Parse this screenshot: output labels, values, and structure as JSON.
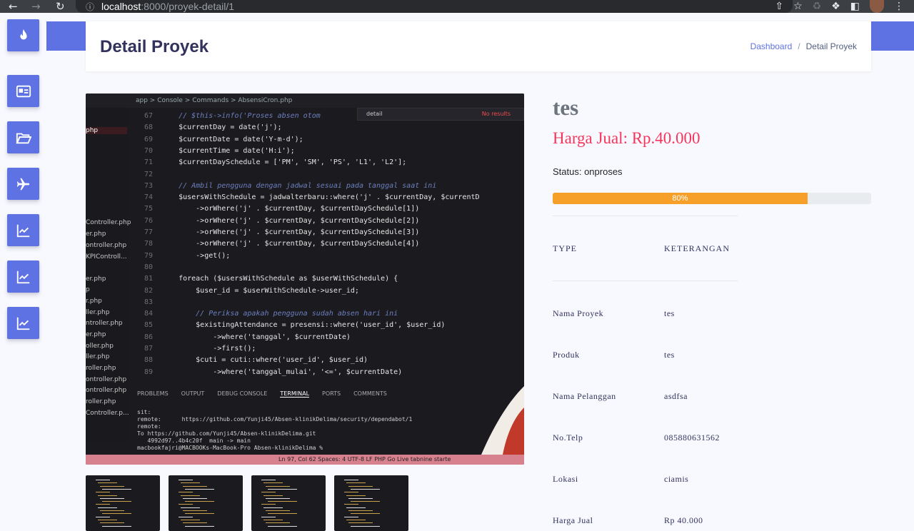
{
  "browser": {
    "url_host": "localhost",
    "url_path": ":8000/proyek-detail/1"
  },
  "header": {
    "title": "Detail Proyek",
    "breadcrumb": [
      {
        "label": "Dashboard"
      },
      {
        "label": "Detail Proyek"
      }
    ]
  },
  "sidebar": {
    "items": [
      {
        "icon": "fire-icon"
      },
      {
        "icon": "id-card-icon"
      },
      {
        "icon": "folder-open-icon"
      },
      {
        "icon": "plane-icon"
      },
      {
        "icon": "chart-line-icon"
      },
      {
        "icon": "chart-line-icon"
      },
      {
        "icon": "chart-line-icon"
      }
    ]
  },
  "product": {
    "name": "tes",
    "price_label": "Harga Jual: Rp.40.000",
    "status_label": "Status: onproses",
    "progress_label": "80%",
    "progress": 0.8
  },
  "table": {
    "headers": [
      "TYPE",
      "KETERANGAN"
    ],
    "rows": [
      {
        "key": "Nama Proyek",
        "value": "tes"
      },
      {
        "key": "Produk",
        "value": "tes"
      },
      {
        "key": "Nama Pelanggan",
        "value": "asdfsa"
      },
      {
        "key": "No.Telp",
        "value": "085880631562"
      },
      {
        "key": "Lokasi",
        "value": "ciamis"
      },
      {
        "key": "Harga Jual",
        "value": "Rp 40.000"
      }
    ]
  },
  "image": {
    "breadcrumb": "app > Console > Commands > AbsensiCron.php",
    "find_query": "detail",
    "find_result": "No results",
    "files": [
      {
        "name": "php",
        "selected": true
      },
      {
        "name": "Controller.php"
      },
      {
        "name": "er.php"
      },
      {
        "name": "ontroller.php"
      },
      {
        "name": "KPIControll..."
      },
      {
        "name": "er.php"
      },
      {
        "name": "p"
      },
      {
        "name": "r.php"
      },
      {
        "name": "ller.php"
      },
      {
        "name": "ntroller.php"
      },
      {
        "name": "er.php"
      },
      {
        "name": "oller.php"
      },
      {
        "name": "ller.php"
      },
      {
        "name": "roller.php"
      },
      {
        "name": "ontroller.php"
      },
      {
        "name": "ontroller.php"
      },
      {
        "name": "roller.php"
      },
      {
        "name": "Controller.p..."
      }
    ],
    "code_lines": [
      {
        "n": "67",
        "t": "    // $this->info('Proses absen otom"
      },
      {
        "n": "68",
        "t": "    $currentDay = date('j');"
      },
      {
        "n": "69",
        "t": "    $currentDate = date('Y-m-d');"
      },
      {
        "n": "70",
        "t": "    $currentTime = date('H:i');"
      },
      {
        "n": "71",
        "t": "    $currentDaySchedule = ['PM', 'SM', 'PS', 'L1', 'L2'];"
      },
      {
        "n": "72",
        "t": ""
      },
      {
        "n": "73",
        "t": "    // Ambil pengguna dengan jadwal sesuai pada tanggal saat ini"
      },
      {
        "n": "74",
        "t": "    $usersWithSchedule = jadwalterbaru::where('j' . $currentDay, $currentD"
      },
      {
        "n": "75",
        "t": "        ->orWhere('j' . $currentDay, $currentDaySchedule[1])"
      },
      {
        "n": "76",
        "t": "        ->orWhere('j' . $currentDay, $currentDaySchedule[2])"
      },
      {
        "n": "77",
        "t": "        ->orWhere('j' . $currentDay, $currentDaySchedule[3])"
      },
      {
        "n": "78",
        "t": "        ->orWhere('j' . $currentDay, $currentDaySchedule[4])"
      },
      {
        "n": "79",
        "t": "        ->get();"
      },
      {
        "n": "80",
        "t": ""
      },
      {
        "n": "81",
        "t": "    foreach ($usersWithSchedule as $userWithSchedule) {"
      },
      {
        "n": "82",
        "t": "        $user_id = $userWithSchedule->user_id;"
      },
      {
        "n": "83",
        "t": ""
      },
      {
        "n": "84",
        "t": "        // Periksa apakah pengguna sudah absen hari ini"
      },
      {
        "n": "85",
        "t": "        $existingAttendance = presensi::where('user_id', $user_id)"
      },
      {
        "n": "86",
        "t": "            ->where('tanggal', $currentDate)"
      },
      {
        "n": "87",
        "t": "            ->first();"
      },
      {
        "n": "88",
        "t": "        $cuti = cuti::where('user_id', $user_id)"
      },
      {
        "n": "89",
        "t": "            ->where('tanggal_mulai', '<=', $currentDate)"
      }
    ],
    "panel_tabs": [
      "PROBLEMS",
      "OUTPUT",
      "DEBUG CONSOLE",
      "TERMINAL",
      "PORTS",
      "COMMENTS"
    ],
    "terminal": "sit:\nremote:      https://github.com/Yunji45/Absen-klinikDelima/security/dependabot/1\nremote:\nTo https://github.com/Yunji45/Absen-klinikDelima.git\n   4992d97..4b4c20f  main -> main\nmacbookfajri@MACBOOKs-MacBook-Pro Absen-klinikDelima % ",
    "status_bar": "Ln 97, Col 62    Spaces: 4    UTF-8    LF    PHP    Go Live         tabnine starte"
  },
  "colors": {
    "primary": "#5e72e4",
    "price": "#f5365c",
    "progress": "#f6a02a"
  }
}
